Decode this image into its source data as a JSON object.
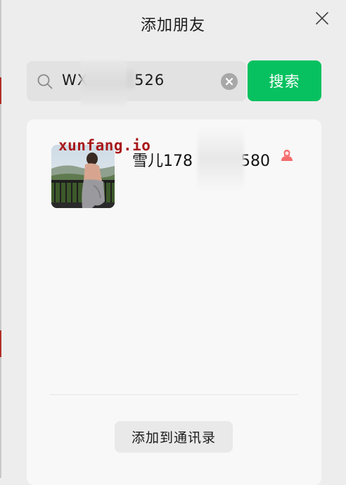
{
  "dialog": {
    "title": "添加朋友",
    "close_icon": "close-icon"
  },
  "search": {
    "value_prefix": "WX",
    "value_suffix": "526",
    "search_icon": "search-icon",
    "clear_icon": "clear-icon",
    "button_label": "搜索"
  },
  "result": {
    "name_prefix": "雪儿178",
    "name_suffix": "580",
    "gender_icon": "female-icon",
    "watermark": "xunfang.io",
    "add_button_label": "添加到通讯录"
  },
  "colors": {
    "accent": "#07c160",
    "gender": "#f46c6c",
    "watermark": "#a8191b"
  }
}
